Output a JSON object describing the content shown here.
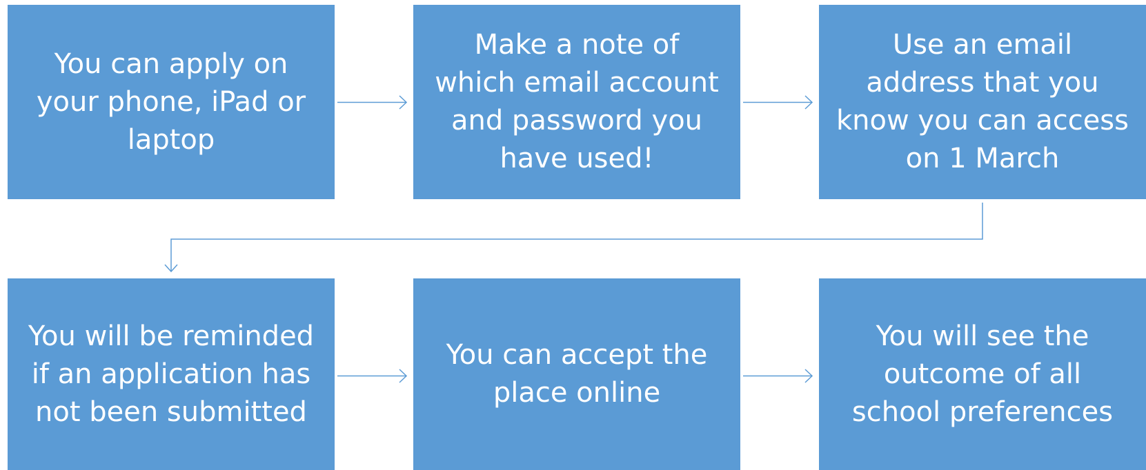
{
  "diagram": {
    "type": "process-flow",
    "steps": [
      {
        "id": 1,
        "text": "You can apply on\nyour phone, iPad or\nlaptop"
      },
      {
        "id": 2,
        "text": "Make a note of\nwhich email account\nand password you\nhave used!"
      },
      {
        "id": 3,
        "text": "Use an email\naddress that you\nknow you can access\non 1 March"
      },
      {
        "id": 4,
        "text": "You will be reminded\nif an application has\nnot been submitted"
      },
      {
        "id": 5,
        "text": "You can accept the\nplace online"
      },
      {
        "id": 6,
        "text": "You will see the\noutcome of all\nschool preferences"
      }
    ],
    "connections": [
      {
        "from": 1,
        "to": 2
      },
      {
        "from": 2,
        "to": 3
      },
      {
        "from": 3,
        "to": 4
      },
      {
        "from": 4,
        "to": 5
      },
      {
        "from": 5,
        "to": 6
      }
    ],
    "colors": {
      "box_fill": "#5b9bd5",
      "box_text": "#ffffff",
      "connector": "#5b9bd5",
      "background": "#ffffff"
    }
  }
}
